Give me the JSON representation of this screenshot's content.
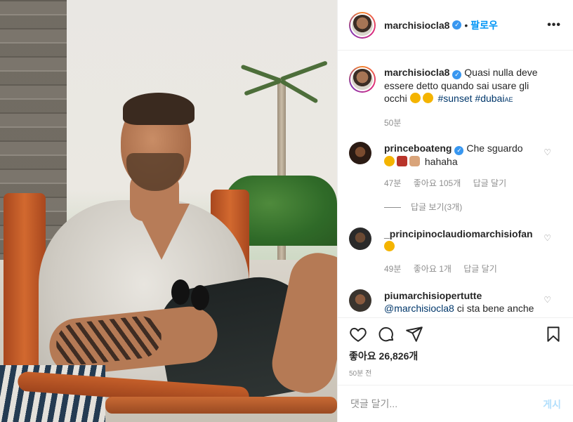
{
  "header": {
    "username": "marchisiocla8",
    "follow_label": "팔로우",
    "separator": "•",
    "more_label": "•••"
  },
  "caption": {
    "username": "marchisiocla8",
    "text": "Quasi nulla deve essere detto quando sai usare gli occhi",
    "hashtags": [
      "#sunset",
      "#dubai"
    ],
    "hashtag_suffix": "AE",
    "time": "50분"
  },
  "comments": [
    {
      "username": "princeboateng",
      "text": "Che sguardo",
      "text2": "hahaha",
      "time": "47분",
      "likes": "좋아요 105개",
      "reply": "답글 달기",
      "view_replies": "답글 보기(3개)"
    },
    {
      "username": "_principinoclaudiomarchisiofan",
      "text": "",
      "time": "49분",
      "likes": "좋아요 1개",
      "reply": "답글 달기"
    },
    {
      "username": "piumarchisiopertutte",
      "mention": "@marchisiocla8",
      "text": "ci sta bene anche"
    }
  ],
  "actions": {
    "likes_text": "좋아요 26,826개",
    "time_ago": "50분 전"
  },
  "add_comment": {
    "placeholder": "댓글 달기...",
    "post_label": "게시"
  },
  "colors": {
    "accent": "#0095f6",
    "verified": "#3897f0",
    "muted": "#8e8e8e",
    "hashtag": "#00376b"
  },
  "icons": [
    "verified-badge-icon",
    "more-options-icon",
    "heart-icon",
    "comment-icon",
    "share-icon",
    "bookmark-icon"
  ]
}
